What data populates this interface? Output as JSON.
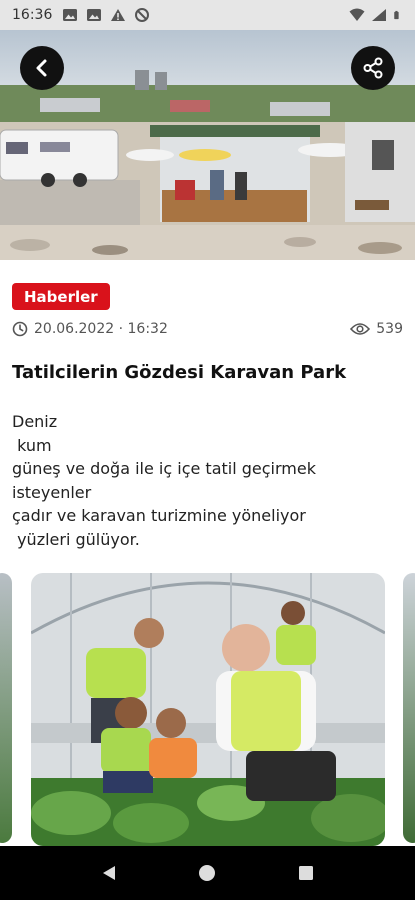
{
  "status_bar": {
    "time": "16:36",
    "left_icons": [
      "gallery-icon",
      "gallery-icon",
      "warning-icon",
      "blocked-icon"
    ],
    "right_icons": [
      "wifi-icon",
      "signal-icon",
      "battery-icon"
    ]
  },
  "hero": {
    "back_icon": "chevron-left-icon",
    "share_icon": "share-icon"
  },
  "article": {
    "category": "Haberler",
    "category_color": "#d9121b",
    "date": "20.06.2022 · 16:32",
    "views": "539",
    "title": "Tatilcilerin Gözdesi Karavan Park",
    "body_lines": [
      "Deniz",
      " kum",
      "güneş ve doğa ile iç içe tatil geçirmek",
      "isteyenler",
      "çadır ve karavan turizmine yöneliyor",
      " yüzleri gülüyor."
    ]
  },
  "nav_bar": {
    "buttons": [
      "back-triangle-icon",
      "home-circle-icon",
      "recents-square-icon"
    ]
  }
}
